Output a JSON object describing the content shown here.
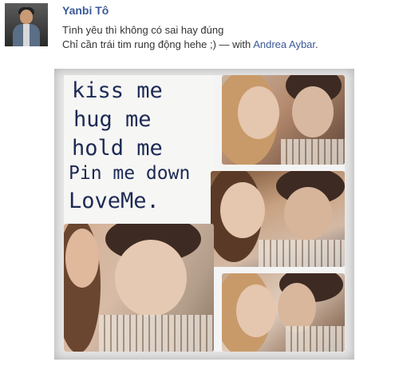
{
  "post": {
    "author": "Yanbi Tô",
    "line1": "Tình yêu thì không có sai hay đúng",
    "line2_prefix": "Chỉ cần trái tim rung động hehe ;) — with ",
    "tagged_friend": "Andrea Aybar",
    "line2_suffix": "."
  },
  "photo": {
    "note_lines": [
      "kiss me",
      "hug me",
      "hold me",
      "Pin me down",
      "LoveMe."
    ]
  }
}
